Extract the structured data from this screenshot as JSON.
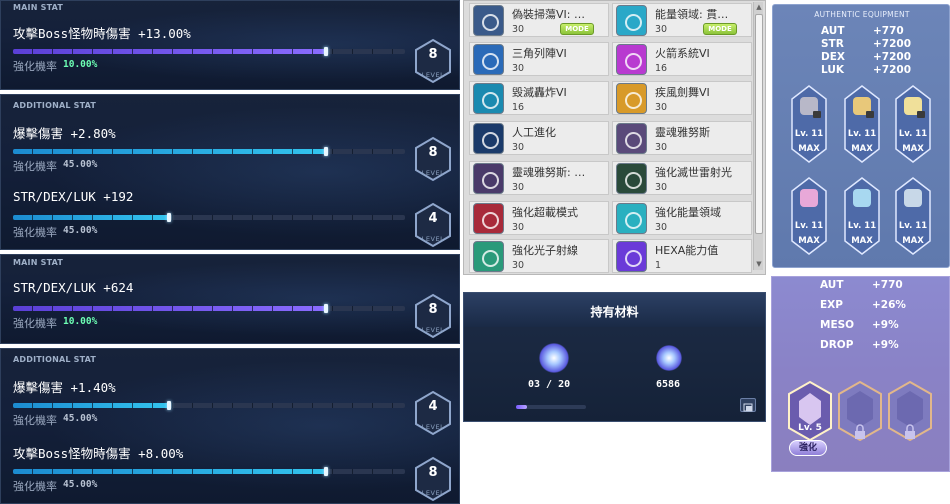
{
  "stat_panels": [
    {
      "header": "MAIN STAT",
      "rows": [
        {
          "name": "攻擊Boss怪物時傷害 +13.00%",
          "rate_label": "強化機率",
          "rate": "10.00%",
          "rate_color": "green",
          "level": "8",
          "level_word": "LEVEL",
          "progress": 0.8,
          "bar": "purple"
        }
      ]
    },
    {
      "header": "ADDITIONAL STAT",
      "rows": [
        {
          "name": "爆擊傷害 +2.80%",
          "rate_label": "強化機率",
          "rate": "45.00%",
          "rate_color": "gray",
          "level": "8",
          "level_word": "LEVEL",
          "progress": 0.8,
          "bar": "cyan"
        },
        {
          "name": "STR/DEX/LUK +192",
          "rate_label": "強化機率",
          "rate": "45.00%",
          "rate_color": "gray",
          "level": "4",
          "level_word": "LEVEL",
          "progress": 0.4,
          "bar": "cyan"
        }
      ]
    },
    {
      "header": "MAIN STAT",
      "rows": [
        {
          "name": "STR/DEX/LUK +624",
          "rate_label": "強化機率",
          "rate": "10.00%",
          "rate_color": "green",
          "level": "8",
          "level_word": "LEVEL",
          "progress": 0.8,
          "bar": "purple"
        }
      ]
    },
    {
      "header": "ADDITIONAL STAT",
      "rows": [
        {
          "name": "爆擊傷害 +1.40%",
          "rate_label": "強化機率",
          "rate": "45.00%",
          "rate_color": "gray",
          "level": "4",
          "level_word": "LEVEL",
          "progress": 0.4,
          "bar": "cyan"
        },
        {
          "name": "攻擊Boss怪物時傷害 +8.00%",
          "rate_label": "強化機率",
          "rate": "45.00%",
          "rate_color": "gray",
          "level": "8",
          "level_word": "LEVEL",
          "progress": 0.8,
          "bar": "cyan"
        }
      ]
    }
  ],
  "skills": [
    {
      "name": "偽裝掃蕩VI: …",
      "level": "30",
      "mode": "MODE",
      "icon_color": "#3a5a8a"
    },
    {
      "name": "能量領域: 貫…",
      "level": "30",
      "mode": "MODE",
      "icon_color": "#2aa8c8"
    },
    {
      "name": "三角列陣VI",
      "level": "30",
      "mode": "",
      "icon_color": "#2a6ab8"
    },
    {
      "name": "火箭系統VI",
      "level": "16",
      "mode": "",
      "icon_color": "#b83ad0"
    },
    {
      "name": "毀滅轟炸VI",
      "level": "16",
      "mode": "",
      "icon_color": "#1a8ab0"
    },
    {
      "name": "疾風劍舞VI",
      "level": "30",
      "mode": "",
      "icon_color": "#d89a2a"
    },
    {
      "name": "人工進化",
      "level": "30",
      "mode": "",
      "icon_color": "#1a3a6a"
    },
    {
      "name": "靈魂雅努斯",
      "level": "30",
      "mode": "",
      "icon_color": "#5a4a7a"
    },
    {
      "name": "靈魂雅努斯: …",
      "level": "30",
      "mode": "",
      "icon_color": "#4a3a6a"
    },
    {
      "name": "強化滅世雷射光",
      "level": "30",
      "mode": "",
      "icon_color": "#2a4a3a"
    },
    {
      "name": "強化超載模式",
      "level": "30",
      "mode": "",
      "icon_color": "#a82a3a"
    },
    {
      "name": "強化能量領域",
      "level": "30",
      "mode": "",
      "icon_color": "#2ab0c0"
    },
    {
      "name": "強化光子射線",
      "level": "30",
      "mode": "",
      "icon_color": "#2a9a7a"
    },
    {
      "name": "HEXA能力值",
      "level": "1",
      "mode": "",
      "icon_color": "#6a3ad8"
    }
  ],
  "materials": {
    "title": "持有材料",
    "fragment_count": "03 / 20",
    "fragment_progress": 0.15,
    "erda_count": "6586"
  },
  "authentic": {
    "title": "AUTHENTIC EQUIPMENT",
    "stats": [
      {
        "k": "AUT",
        "v": "+770"
      },
      {
        "k": "STR",
        "v": "+7200"
      },
      {
        "k": "DEX",
        "v": "+7200"
      },
      {
        "k": "LUK",
        "v": "+7200"
      }
    ],
    "symbols": [
      {
        "lv": "Lv. 11",
        "max": "MAX",
        "color": "#b8b8c8"
      },
      {
        "lv": "Lv. 11",
        "max": "MAX",
        "color": "#e8c87a"
      },
      {
        "lv": "Lv. 11",
        "max": "MAX",
        "color": "#f0e09a"
      },
      {
        "lv": "Lv. 11",
        "max": "MAX",
        "color": "#e8a8d8"
      },
      {
        "lv": "Lv. 11",
        "max": "MAX",
        "color": "#a8d8f0"
      },
      {
        "lv": "Lv. 11",
        "max": "MAX",
        "color": "#c8d8e8"
      }
    ]
  },
  "bonus": {
    "stats": [
      {
        "k": "AUT",
        "v": "+770"
      },
      {
        "k": "EXP",
        "v": "+26%"
      },
      {
        "k": "MESO",
        "v": "+9%"
      },
      {
        "k": "DROP",
        "v": "+9%"
      }
    ],
    "slot_lv": "Lv. 5",
    "enhance": "強化"
  }
}
